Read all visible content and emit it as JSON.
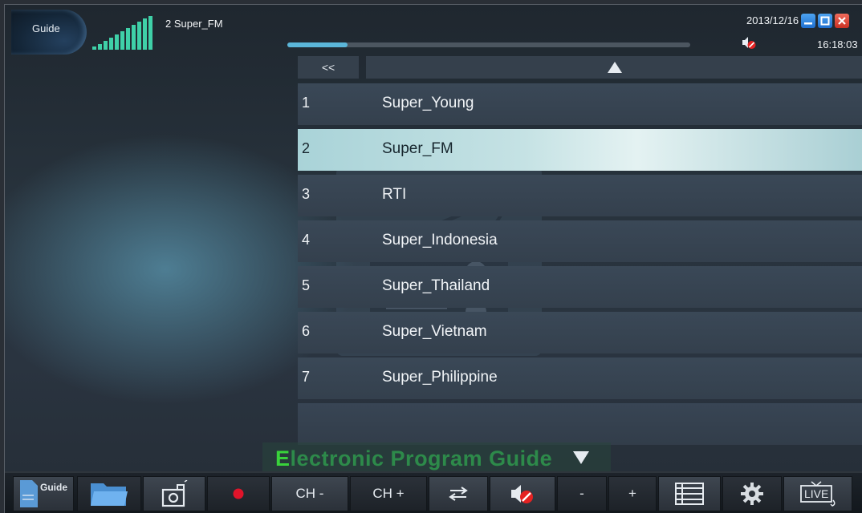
{
  "header": {
    "guide_label": "Guide",
    "current_channel": "2 Super_FM",
    "date": "2013/12/16",
    "time": "16:18:03",
    "progress_fraction": 0.15
  },
  "nav": {
    "back_label": "<<"
  },
  "channels": [
    {
      "num": "1",
      "name": "Super_Young"
    },
    {
      "num": "2",
      "name": "Super_FM",
      "selected": true
    },
    {
      "num": "3",
      "name": "RTI"
    },
    {
      "num": "4",
      "name": "Super_Indonesia"
    },
    {
      "num": "5",
      "name": "Super_Thailand"
    },
    {
      "num": "6",
      "name": "Super_Vietnam"
    },
    {
      "num": "7",
      "name": "Super_Philippine"
    }
  ],
  "epg": {
    "title_first": "E",
    "title_rest": "lectronic Program Guide"
  },
  "toolbar": {
    "guide_label": "Guide",
    "ch_minus": "CH -",
    "ch_plus": "CH +",
    "vol_minus": "-",
    "vol_plus": "+",
    "live_label": "LIVE"
  },
  "icons": {
    "signal": "signal-strength-icon",
    "mute": "mute-icon",
    "radio": "radio-icon",
    "folder": "folder-icon",
    "camera": "snapshot-icon",
    "record": "record-icon",
    "swap": "swap-icon",
    "list": "list-icon",
    "settings": "gear-icon",
    "live": "live-tv-icon"
  },
  "colors": {
    "accent": "#5bb6d9",
    "selected_row": "#c5e2e4",
    "record": "#e0142a",
    "epg_first_letter": "#39d33b"
  }
}
